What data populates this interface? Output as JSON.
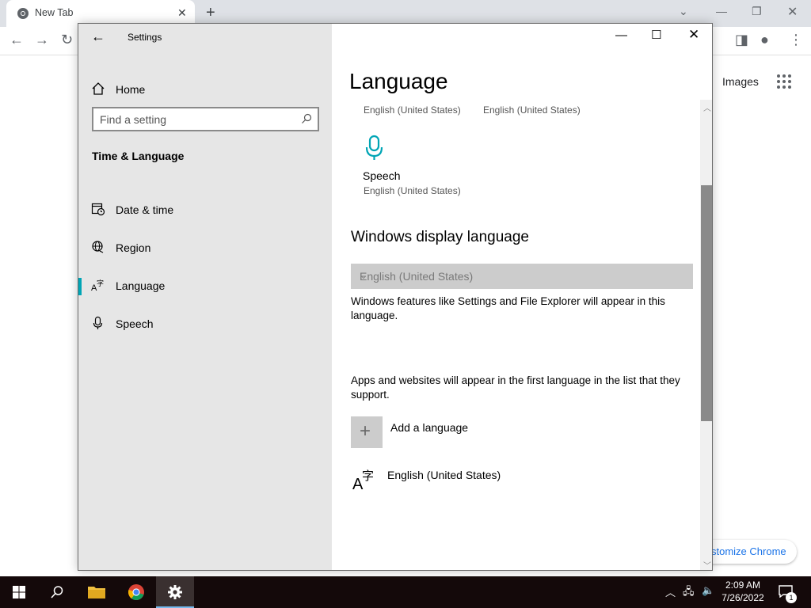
{
  "browser": {
    "tab_title": "New Tab",
    "tab_close": "✕",
    "new_tab": "+",
    "images_link": "Images",
    "customize": "stomize Chrome"
  },
  "window": {
    "title": "Settings"
  },
  "sidebar": {
    "home_label": "Home",
    "search_placeholder": "Find a setting",
    "section_title": "Time & Language",
    "items": [
      {
        "label": "Date & time",
        "icon": "calendar-clock-icon"
      },
      {
        "label": "Region",
        "icon": "globe-icon"
      },
      {
        "label": "Language",
        "icon": "language-icon",
        "active": true
      },
      {
        "label": "Speech",
        "icon": "microphone-icon"
      }
    ]
  },
  "content": {
    "page_title": "Language",
    "top_values": [
      "English (United States)",
      "English (United States)"
    ],
    "speech": {
      "label": "Speech",
      "value": "English (United States)"
    },
    "display_language": {
      "title": "Windows display language",
      "selected": "English (United States)",
      "description": "Windows features like Settings and File Explorer will appear in this language."
    },
    "preferred": {
      "description": "Apps and websites will appear in the first language in the list that they support.",
      "add_label": "Add a language",
      "languages": [
        "English (United States)"
      ]
    }
  },
  "taskbar": {
    "time": "2:09 AM",
    "date": "7/26/2022",
    "notifications": "1"
  },
  "colors": {
    "accent": "#00a5b5",
    "sidebar_bg": "#e6e6e6",
    "taskbar_bg": "#14090a"
  }
}
